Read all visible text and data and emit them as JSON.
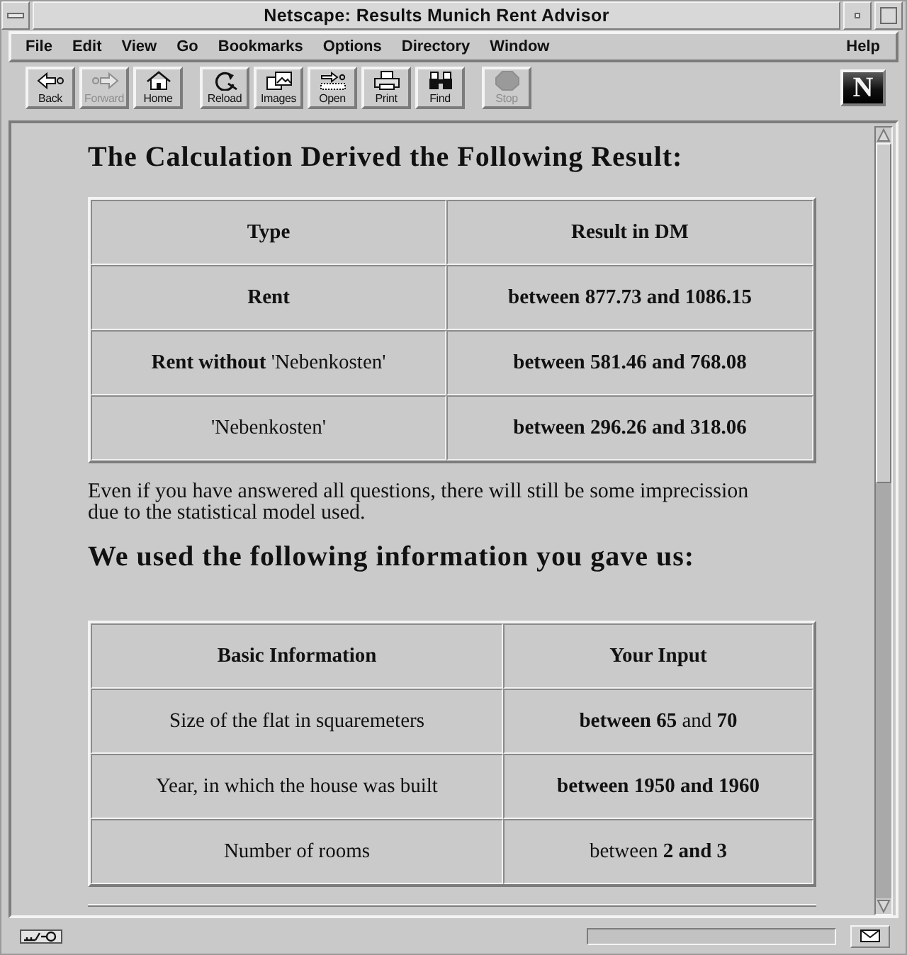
{
  "window": {
    "title": "Netscape: Results Munich Rent Advisor"
  },
  "menu": {
    "items": [
      "File",
      "Edit",
      "View",
      "Go",
      "Bookmarks",
      "Options",
      "Directory",
      "Window"
    ],
    "help": "Help"
  },
  "toolbar": {
    "groups": [
      [
        {
          "label": "Back",
          "disabled": false
        },
        {
          "label": "Forward",
          "disabled": true
        },
        {
          "label": "Home",
          "disabled": false
        }
      ],
      [
        {
          "label": "Reload",
          "disabled": false
        },
        {
          "label": "Images",
          "disabled": false
        },
        {
          "label": "Open",
          "disabled": false
        },
        {
          "label": "Print",
          "disabled": false
        },
        {
          "label": "Find",
          "disabled": false
        }
      ],
      [
        {
          "label": "Stop",
          "disabled": true
        }
      ]
    ],
    "logo": "N"
  },
  "page": {
    "blocks": [
      {
        "kind": "heading",
        "text": "The Calculation Derived the Following Result:"
      },
      {
        "kind": "table",
        "columns": [
          "Type",
          "Result in DM"
        ],
        "rows": [
          [
            {
              "text": "Rent",
              "strong": true
            },
            {
              "text": "between 877.73 and 1086.15",
              "strong": true
            }
          ],
          [
            {
              "text": "**Rent without** 'Nebenkosten'",
              "strong": false
            },
            {
              "text": "between 581.46 and 768.08",
              "strong": true
            }
          ],
          [
            {
              "text": "'Nebenkosten'",
              "strong": false
            },
            {
              "text": "between 296.26 and 318.06",
              "strong": true
            }
          ]
        ]
      },
      {
        "kind": "paragraph",
        "text": "Even if you have answered all questions, there will still be some imprecission due to the statistical model used."
      },
      {
        "kind": "heading",
        "text": "We used the following information you gave us:"
      },
      {
        "kind": "table",
        "columns": [
          "Basic Information",
          "Your Input"
        ],
        "rows": [
          [
            {
              "text": "Size of the flat in squaremeters",
              "strong": false
            },
            {
              "text": "**between 65** and **70**",
              "strong": false
            }
          ],
          [
            {
              "text": "Year, in which the house was built",
              "strong": false
            },
            {
              "text": "between 1950 and 1960",
              "strong": true
            }
          ],
          [
            {
              "text": "Number of rooms",
              "strong": false
            },
            {
              "text": "between **2 and 3**",
              "strong": false
            }
          ]
        ]
      }
    ]
  }
}
